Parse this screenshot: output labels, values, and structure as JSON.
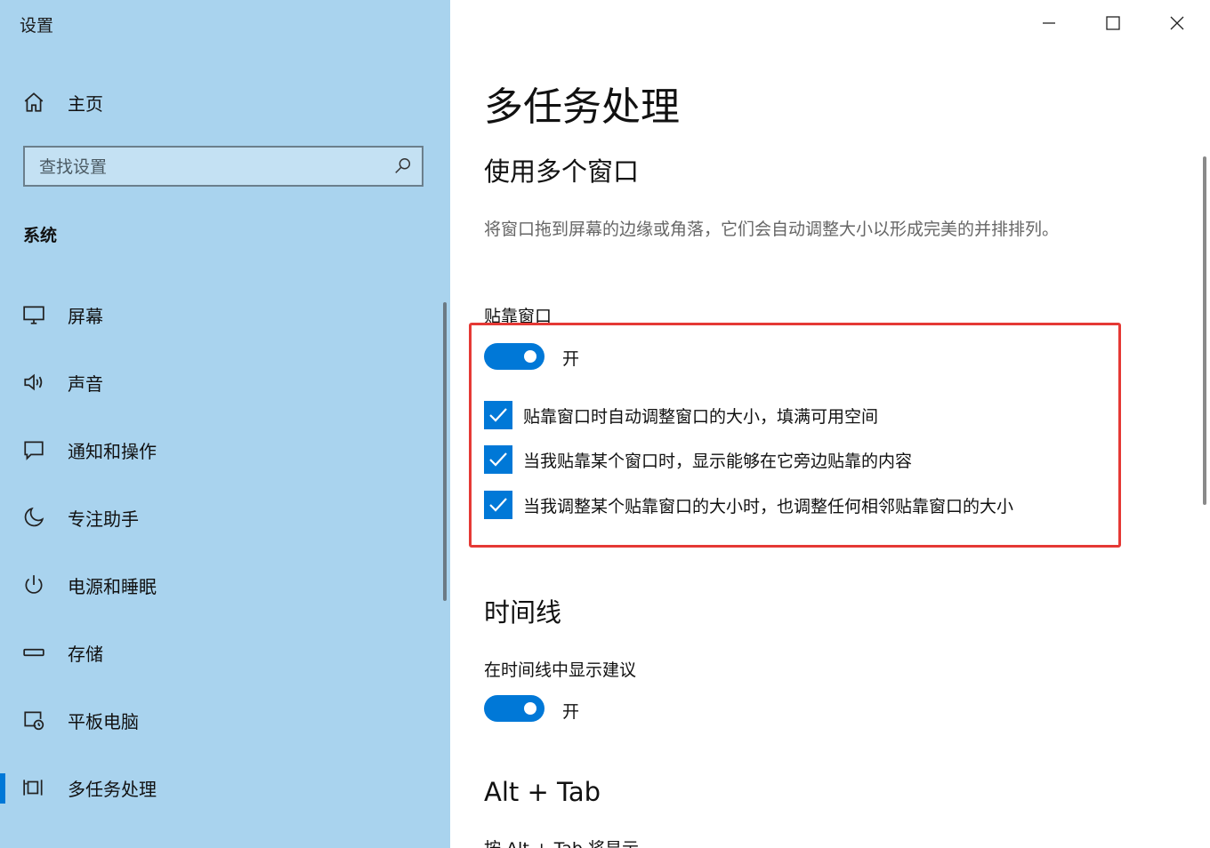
{
  "window": {
    "app_title": "设置"
  },
  "sidebar": {
    "home_label": "主页",
    "search_placeholder": "查找设置",
    "group_heading": "系统",
    "items": [
      {
        "label": "屏幕",
        "icon": "monitor-icon"
      },
      {
        "label": "声音",
        "icon": "speaker-icon"
      },
      {
        "label": "通知和操作",
        "icon": "notification-icon"
      },
      {
        "label": "专注助手",
        "icon": "moon-icon"
      },
      {
        "label": "电源和睡眠",
        "icon": "power-icon"
      },
      {
        "label": "存储",
        "icon": "storage-icon"
      },
      {
        "label": "平板电脑",
        "icon": "tablet-icon"
      },
      {
        "label": "多任务处理",
        "icon": "multitasking-icon",
        "selected": true
      }
    ]
  },
  "main": {
    "page_title": "多任务处理",
    "multi_window": {
      "title": "使用多个窗口",
      "description": "将窗口拖到屏幕的边缘或角落，它们会自动调整大小以形成完美的并排排列。",
      "snap_label": "贴靠窗口",
      "snap_toggle": {
        "state_text": "开",
        "on": true
      },
      "options": [
        {
          "label": "贴靠窗口时自动调整窗口的大小，填满可用空间",
          "checked": true
        },
        {
          "label": "当我贴靠某个窗口时，显示能够在它旁边贴靠的内容",
          "checked": true
        },
        {
          "label": "当我调整某个贴靠窗口的大小时，也调整任何相邻贴靠窗口的大小",
          "checked": true
        }
      ]
    },
    "timeline": {
      "title": "时间线",
      "suggest_label": "在时间线中显示建议",
      "toggle": {
        "state_text": "开",
        "on": true
      }
    },
    "alt_tab": {
      "title": "Alt + Tab",
      "partial_label": "按 Alt + Tab 将显示"
    }
  },
  "colors": {
    "accent": "#0078d7",
    "sidebar_bg": "#a9d3ee",
    "highlight": "#e53935"
  }
}
